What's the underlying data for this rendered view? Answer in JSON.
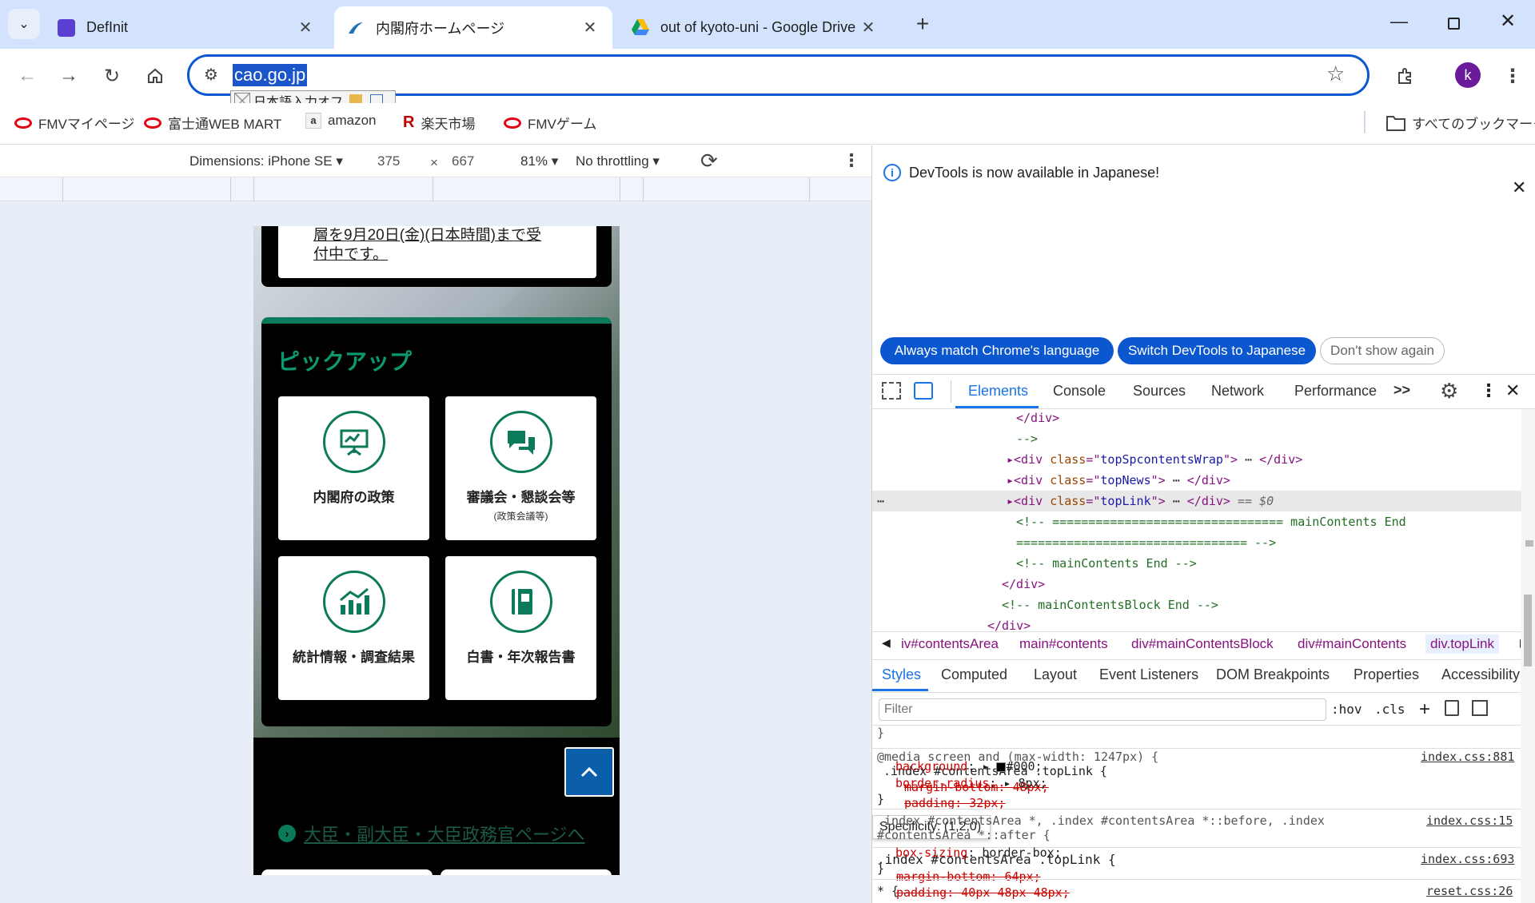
{
  "browser": {
    "tabs": [
      {
        "title": "DefInit",
        "icon": "definit-icon"
      },
      {
        "title": "内閣府ホームページ",
        "icon": "cao-logo-icon"
      },
      {
        "title": "out of kyoto-uni - Google Drive",
        "icon": "google-drive-icon"
      }
    ],
    "new_tab": "+",
    "url": "cao.go.jp",
    "ime_label": "日本語入力オフ",
    "profile_initial": "k",
    "bookmarks": [
      "FMVマイページ",
      "富士通WEB MART",
      "amazon",
      "楽天市場",
      "FMVゲーム"
    ],
    "all_bookmarks": "すべてのブックマーク"
  },
  "device_toolbar": {
    "dimensions": "Dimensions: iPhone SE",
    "width": "375",
    "times": "×",
    "height": "667",
    "zoom": "81%",
    "throttling": "No throttling"
  },
  "page": {
    "top_text_line1": "層を9月20日(金)(日本時間)まで受",
    "top_text_line2": "付中です。",
    "pickup_title": "ピックアップ",
    "cards": [
      {
        "label": "内閣府の政策",
        "sub": "",
        "icon": "presentation-icon"
      },
      {
        "label": "審議会・懇談会等",
        "sub": "(政策会議等)",
        "icon": "chat-bubbles-icon"
      },
      {
        "label": "統計情報・調査結果",
        "sub": "",
        "icon": "bar-chart-icon"
      },
      {
        "label": "白書・年次報告書",
        "sub": "",
        "icon": "book-icon"
      }
    ],
    "minister_link": "大臣・副大臣・大臣政務官ページへ",
    "back_to_top": "^"
  },
  "devtools": {
    "notice": "DevTools is now available in Japanese!",
    "btn_always_match": "Always match Chrome's language",
    "btn_switch": "Switch DevTools to Japanese",
    "btn_dont_show": "Don't show again",
    "tabs": [
      "Elements",
      "Console",
      "Sources",
      "Network",
      "Performance"
    ],
    "more_tabs": ">>",
    "dom": {
      "l1": "</div>",
      "l2": "-->",
      "l3_class": "topSpcontentsWrap",
      "l4_class": "topNews",
      "l5_class": "topLink",
      "l5_suffix": "== $0",
      "l6": "<!-- ================================ mainContents End",
      "l7": "================================ -->",
      "l8": "<!-- mainContents End -->",
      "l9": "</div>",
      "l10": "<!-- mainContentsBlock End -->",
      "l11": "</div>"
    },
    "breadcrumbs": [
      "iv#contentsArea",
      "main#contents",
      "div#mainContentsBlock",
      "div#mainContents",
      "div.topLink"
    ],
    "subtabs": [
      "Styles",
      "Computed",
      "Layout",
      "Event Listeners",
      "DOM Breakpoints",
      "Properties",
      "Accessibility"
    ],
    "filter_placeholder": "Filter",
    "hov": ":hov",
    "cls": ".cls",
    "css": {
      "media": "@media screen and (max-width: 1247px) {",
      "rule1_selector": ".index #contentsArea .topLink {",
      "rule1_source": "index.css:881",
      "rule1_p1": "margin-bottom: 48px;",
      "rule1_p2": "padding: 32px;",
      "tooltip": "Specificity: (1,2,0)",
      "rule2_selector": ".index #contentsArea .topLink {",
      "rule2_source": "index.css:693",
      "rule2_p1": "margin-bottom: 64px;",
      "rule2_p2": "padding: 40px 48px 48px;",
      "rule2_p3_name": "background",
      "rule2_p3_val": "#000;",
      "rule2_p4_name": "border-radius",
      "rule2_p4_val": "8px;",
      "rule3_selector": ".index #contentsArea *, .index #contentsArea *::before, .index",
      "rule3_selector2": "#contentsArea *::after {",
      "rule3_source": "index.css:15",
      "rule3_p1_name": "box-sizing",
      "rule3_p1_val": "border-box;",
      "rule4_selector": "* {",
      "rule4_source": "reset.css:26"
    }
  },
  "colors": {
    "accent": "#0b57d0",
    "tabstrip": "#d3e3fd",
    "cao_green": "#0b7a5a"
  }
}
